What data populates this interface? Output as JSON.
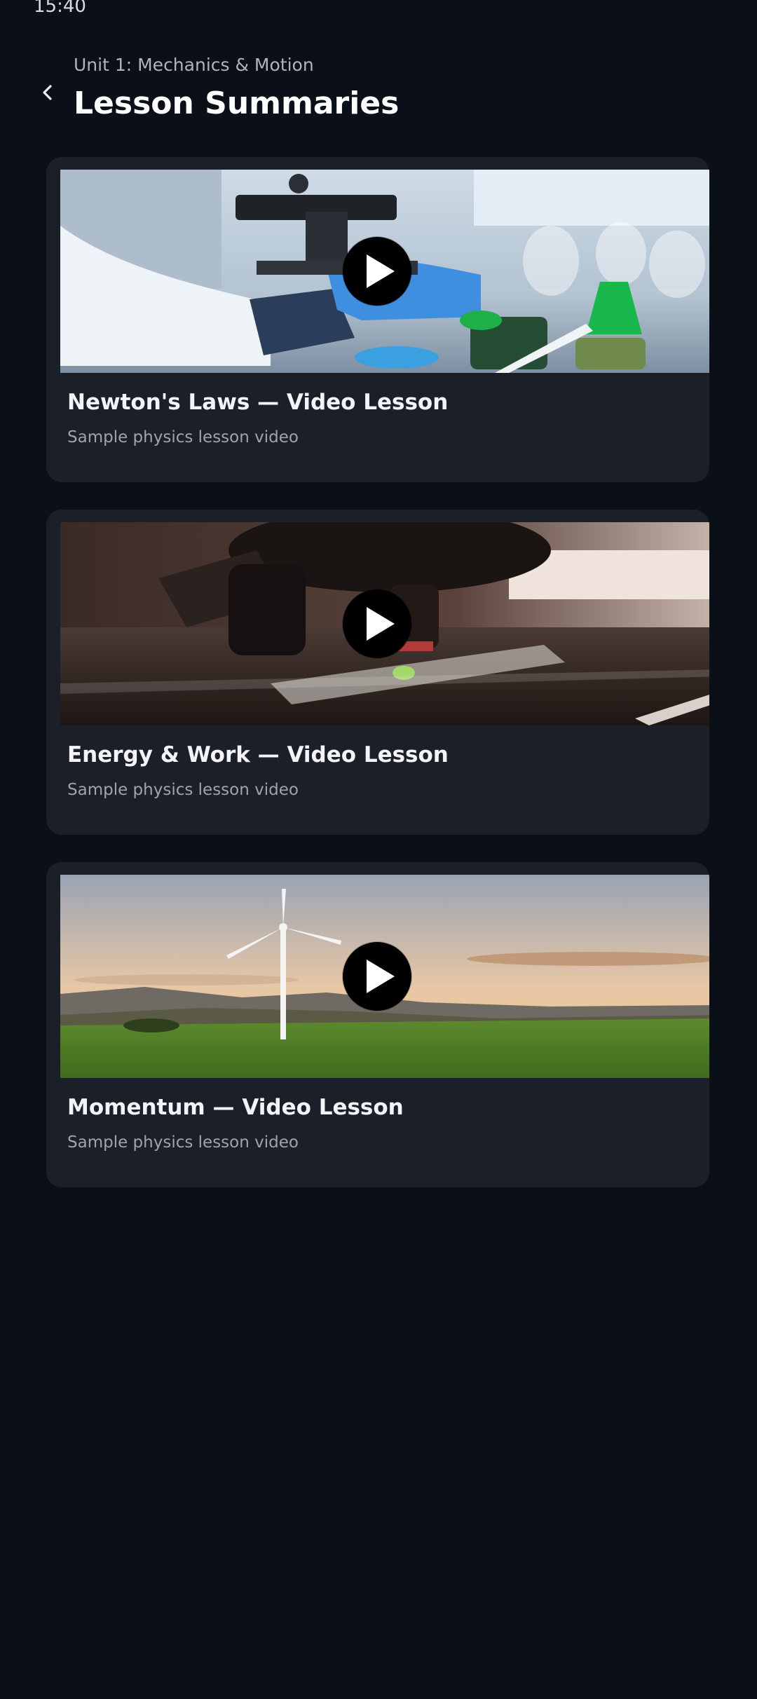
{
  "status_bar": {
    "time": "15:40"
  },
  "header": {
    "back_icon": "chevron-left-icon",
    "subtitle": "Unit 1: Mechanics & Motion",
    "title": "Lesson Summaries"
  },
  "lessons": [
    {
      "title": "Newton's Laws — Video Lesson",
      "subtitle": "Sample physics lesson video",
      "thumbnail": "laboratory-microscope-image",
      "play_icon": "play-icon"
    },
    {
      "title": "Energy & Work — Video Lesson",
      "subtitle": "Sample physics lesson video",
      "thumbnail": "microscope-closeup-image",
      "play_icon": "play-icon"
    },
    {
      "title": "Momentum — Video Lesson",
      "subtitle": "Sample physics lesson video",
      "thumbnail": "wind-turbine-landscape-image",
      "play_icon": "play-icon"
    }
  ],
  "colors": {
    "background": "#0b0f17",
    "card": "#1b1f28",
    "title_text": "#f3f4f7",
    "secondary_text": "#9ea4ae"
  }
}
